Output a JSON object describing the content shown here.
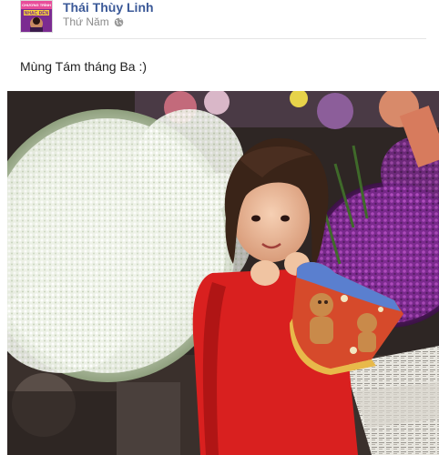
{
  "post": {
    "author": "Thái Thùy Linh",
    "date": "Thứ Năm",
    "privacy_icon": "globe-icon",
    "text": "Mùng Tám tháng Ba :)",
    "avatar_caption": [
      "CHƯƠNG TRÌNH",
      "NHẠC ĐẾN"
    ]
  },
  "colors": {
    "author_link": "#3b5998",
    "meta_text": "#8b8b8b",
    "divider": "#e5e5e5",
    "dress": "#d9201f",
    "purple_flowers": "#7a2a8c",
    "white_flowers": "#f1f4ee"
  }
}
